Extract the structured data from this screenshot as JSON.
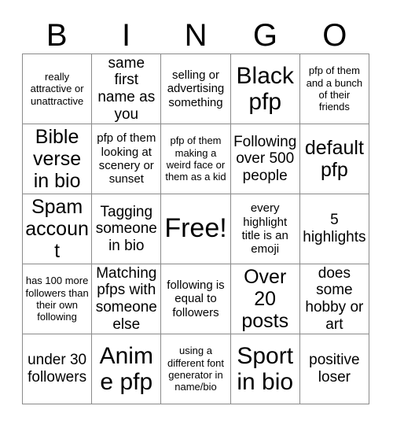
{
  "card": {
    "header_letters": [
      "B",
      "I",
      "N",
      "G",
      "O"
    ],
    "columns": 5,
    "rows": 5,
    "border_color": "#8a8a8a",
    "background_color": "#ffffff",
    "text_color": "#000000",
    "cells": [
      {
        "text": "really attractive or unattractive",
        "size": "xs"
      },
      {
        "text": "same first name as you",
        "size": "md"
      },
      {
        "text": "selling or advertising something",
        "size": "sm"
      },
      {
        "text": "Black pfp",
        "size": "xl"
      },
      {
        "text": "pfp of them and a bunch of their friends",
        "size": "xs"
      },
      {
        "text": "Bible verse in bio",
        "size": "lg"
      },
      {
        "text": "pfp of them looking at scenery or sunset",
        "size": "sm"
      },
      {
        "text": "pfp of them making a weird face or them as a kid",
        "size": "xs"
      },
      {
        "text": "Following over 500 people",
        "size": "md"
      },
      {
        "text": "default pfp",
        "size": "lg"
      },
      {
        "text": "Spam account",
        "size": "lg"
      },
      {
        "text": "Tagging someone in bio",
        "size": "md"
      },
      {
        "text": "Free!",
        "size": "free"
      },
      {
        "text": "every highlight title is an emoji",
        "size": "sm"
      },
      {
        "text": "5 highlights",
        "size": "md"
      },
      {
        "text": "has 100 more followers than their own following",
        "size": "xs"
      },
      {
        "text": "Matching pfps with someone else",
        "size": "md"
      },
      {
        "text": "following is equal to followers",
        "size": "sm"
      },
      {
        "text": "Over 20 posts",
        "size": "lg"
      },
      {
        "text": "does some hobby or art",
        "size": "md"
      },
      {
        "text": "under 30 followers",
        "size": "md"
      },
      {
        "text": "Anime pfp",
        "size": "xl"
      },
      {
        "text": "using a different font generator in name/bio",
        "size": "xs"
      },
      {
        "text": "Sport in bio",
        "size": "xl"
      },
      {
        "text": "positive loser",
        "size": "md"
      }
    ]
  }
}
